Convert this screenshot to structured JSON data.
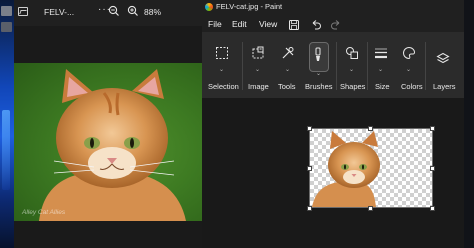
{
  "photos": {
    "title": "FELV-...",
    "zoom_level": "88%",
    "watermark": "Alley Cat Allies",
    "more_label": "···"
  },
  "paint": {
    "window_title": "FELV-cat.jpg - Paint",
    "menu": {
      "file": "File",
      "edit": "Edit",
      "view": "View"
    },
    "ribbon": {
      "selection": "Selection",
      "image": "Image",
      "tools": "Tools",
      "brushes": "Brushes",
      "shapes": "Shapes",
      "size": "Size",
      "colors": "Colors",
      "layers": "Layers"
    }
  },
  "colors": {
    "paint_bg": "#202020",
    "ribbon_bg": "#2b2b2b",
    "canvas_area": "#191919"
  }
}
